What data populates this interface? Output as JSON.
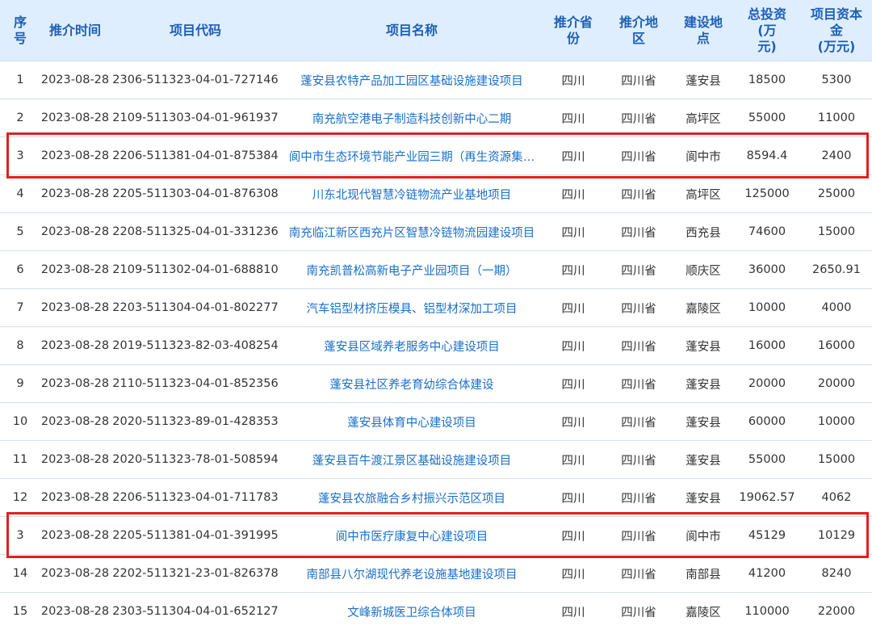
{
  "headers": {
    "seq": "序\n号",
    "date": "推介时间",
    "code": "项目代码",
    "name": "项目名称",
    "province": "推介省\n份",
    "region": "推介地\n区",
    "location": "建设地\n点",
    "investment": "总投资\n(万\n元)",
    "capital": "项目资本\n金\n(万元)"
  },
  "rows": [
    {
      "seq": "1",
      "date": "2023-08-28",
      "code": "2306-511323-04-01-727146",
      "name": "蓬安县农特产品加工园区基础设施建设项目",
      "province": "四川",
      "region": "四川省",
      "location": "蓬安县",
      "investment": "18500",
      "capital": "5300"
    },
    {
      "seq": "2",
      "date": "2023-08-28",
      "code": "2109-511303-04-01-961937",
      "name": "南充航空港电子制造科技创新中心二期",
      "province": "四川",
      "region": "四川省",
      "location": "高坪区",
      "investment": "55000",
      "capital": "11000"
    },
    {
      "seq": "3",
      "date": "2023-08-28",
      "code": "2206-511381-04-01-875384",
      "name": "阆中市生态环境节能产业园三期（再生资源集…",
      "province": "四川",
      "region": "四川省",
      "location": "阆中市",
      "investment": "8594.4",
      "capital": "2400"
    },
    {
      "seq": "4",
      "date": "2023-08-28",
      "code": "2205-511303-04-01-876308",
      "name": "川东北现代智慧冷链物流产业基地项目",
      "province": "四川",
      "region": "四川省",
      "location": "高坪区",
      "investment": "125000",
      "capital": "25000"
    },
    {
      "seq": "5",
      "date": "2023-08-28",
      "code": "2208-511325-04-01-331236",
      "name": "南充临江新区西充片区智慧冷链物流园建设项目",
      "province": "四川",
      "region": "四川省",
      "location": "西充县",
      "investment": "74600",
      "capital": "15000"
    },
    {
      "seq": "6",
      "date": "2023-08-28",
      "code": "2109-511302-04-01-688810",
      "name": "南充凯普松高新电子产业园项目（一期）",
      "province": "四川",
      "region": "四川省",
      "location": "顺庆区",
      "investment": "36000",
      "capital": "2650.91"
    },
    {
      "seq": "7",
      "date": "2023-08-28",
      "code": "2203-511304-04-01-802277",
      "name": "汽车铝型材挤压模具、铝型材深加工项目",
      "province": "四川",
      "region": "四川省",
      "location": "嘉陵区",
      "investment": "10000",
      "capital": "4000"
    },
    {
      "seq": "8",
      "date": "2023-08-28",
      "code": "2019-511323-82-03-408254",
      "name": "蓬安县区域养老服务中心建设项目",
      "province": "四川",
      "region": "四川省",
      "location": "蓬安县",
      "investment": "16000",
      "capital": "16000"
    },
    {
      "seq": "9",
      "date": "2023-08-28",
      "code": "2110-511323-04-01-852356",
      "name": "蓬安县社区养老育幼综合体建设",
      "province": "四川",
      "region": "四川省",
      "location": "蓬安县",
      "investment": "20000",
      "capital": "20000"
    },
    {
      "seq": "10",
      "date": "2023-08-28",
      "code": "2020-511323-89-01-428353",
      "name": "蓬安县体育中心建设项目",
      "province": "四川",
      "region": "四川省",
      "location": "蓬安县",
      "investment": "60000",
      "capital": "10000"
    },
    {
      "seq": "11",
      "date": "2023-08-28",
      "code": "2020-511323-78-01-508594",
      "name": "蓬安县百牛渡江景区基础设施建设项目",
      "province": "四川",
      "region": "四川省",
      "location": "蓬安县",
      "investment": "55000",
      "capital": "15000"
    },
    {
      "seq": "12",
      "date": "2023-08-28",
      "code": "2206-511323-04-01-711783",
      "name": "蓬安县农旅融合乡村振兴示范区项目",
      "province": "四川",
      "region": "四川省",
      "location": "蓬安县",
      "investment": "19062.57",
      "capital": "4062"
    },
    {
      "seq": "3",
      "date": "2023-08-28",
      "code": "2205-511381-04-01-391995",
      "name": "阆中市医疗康复中心建设项目",
      "province": "四川",
      "region": "四川省",
      "location": "阆中市",
      "investment": "45129",
      "capital": "10129"
    },
    {
      "seq": "14",
      "date": "2023-08-28",
      "code": "2202-511321-23-01-826378",
      "name": "南部县八尔湖现代养老设施基地建设项目",
      "province": "四川",
      "region": "四川省",
      "location": "南部县",
      "investment": "41200",
      "capital": "8240"
    },
    {
      "seq": "15",
      "date": "2023-08-28",
      "code": "2303-511304-04-01-652127",
      "name": "文峰新城医卫综合体项目",
      "province": "四川",
      "region": "四川省",
      "location": "嘉陵区",
      "investment": "110000",
      "capital": "22000"
    }
  ],
  "highlighted_rows": [
    2,
    12
  ],
  "colors": {
    "header_bg": "#dfeefe",
    "header_text": "#1d5fb6",
    "link": "#1a6fc9",
    "highlight": "#e02020"
  }
}
